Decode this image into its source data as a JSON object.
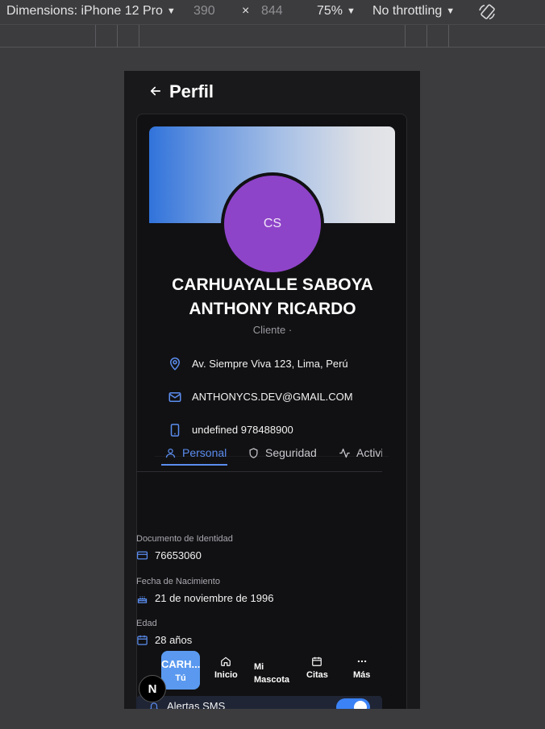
{
  "devtools": {
    "device": "Dimensions: iPhone 12 Pro",
    "width": "390",
    "times": "×",
    "height": "844",
    "zoom": "75%",
    "throttling": "No throttling"
  },
  "header": {
    "title": "Perfil"
  },
  "profile": {
    "initials": "CS",
    "name_line1": "CARHUAYALLE SABOYA",
    "name_line2": "ANTHONY RICARDO",
    "role": "Cliente ·",
    "address": "Av. Siempre Viva 123, Lima, Perú",
    "email": "ANTHONYCS.DEV@GMAIL.COM",
    "phone": "undefined 978488900"
  },
  "tabs": [
    {
      "label": "Personal",
      "icon": "user-icon",
      "active": true
    },
    {
      "label": "Seguridad",
      "icon": "shield-icon",
      "active": false
    },
    {
      "label": "Actividad",
      "icon": "activity-icon",
      "active": false
    }
  ],
  "fields": [
    {
      "label": "Documento de Identidad",
      "value": "76653060",
      "icon": "id-card-icon"
    },
    {
      "label": "Fecha de Nacimiento",
      "value": "21 de noviembre de 1996",
      "icon": "cake-icon"
    },
    {
      "label": "Edad",
      "value": "28 años",
      "icon": "calendar-icon"
    }
  ],
  "alerts": {
    "sms_label": "Alertas SMS",
    "sms_enabled": true
  },
  "bottom_nav": {
    "you_abbrev": "CARH...",
    "you_label": "Tú",
    "items": [
      {
        "label": "Inicio",
        "icon": "home-icon"
      },
      {
        "label_line1": "Mi",
        "label_line2": "Mascota",
        "icon": "paw-icon"
      },
      {
        "label": "Citas",
        "icon": "calendar-icon"
      },
      {
        "label": "Más",
        "icon": "more-icon"
      }
    ]
  },
  "next_badge": "N",
  "colors": {
    "accent": "#5b8def",
    "avatar": "#8e44c9",
    "banner_start": "#3173db",
    "banner_end": "#e4e5e8"
  }
}
